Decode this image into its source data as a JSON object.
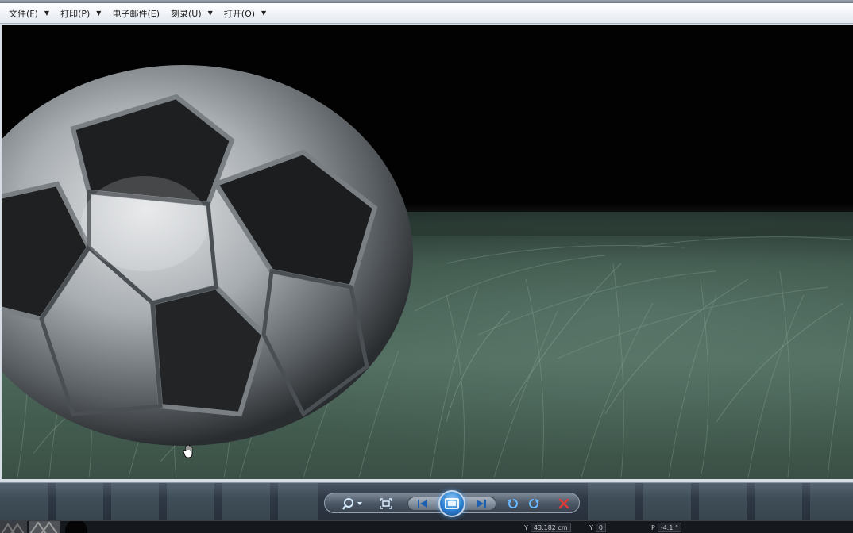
{
  "menubar": {
    "items": [
      {
        "label": "文件(F)"
      },
      {
        "label": "打印(P)"
      },
      {
        "label": "电子邮件(E)"
      },
      {
        "label": "刻录(U)"
      },
      {
        "label": "打开(O)"
      }
    ]
  },
  "toolbar": {
    "icons": [
      "zoom-icon",
      "fit-window-icon",
      "previous-icon",
      "slideshow-icon",
      "next-icon",
      "rotate-left-icon",
      "rotate-right-icon",
      "delete-icon"
    ],
    "accent": "#2b7fd1",
    "delete_color": "#e03a3a"
  },
  "status": {
    "y_label": "Y",
    "y_value": "43.182 cm",
    "y2_label": "Y",
    "y2_value": "0",
    "p_label": "P",
    "p_value": "-4.1 °"
  }
}
